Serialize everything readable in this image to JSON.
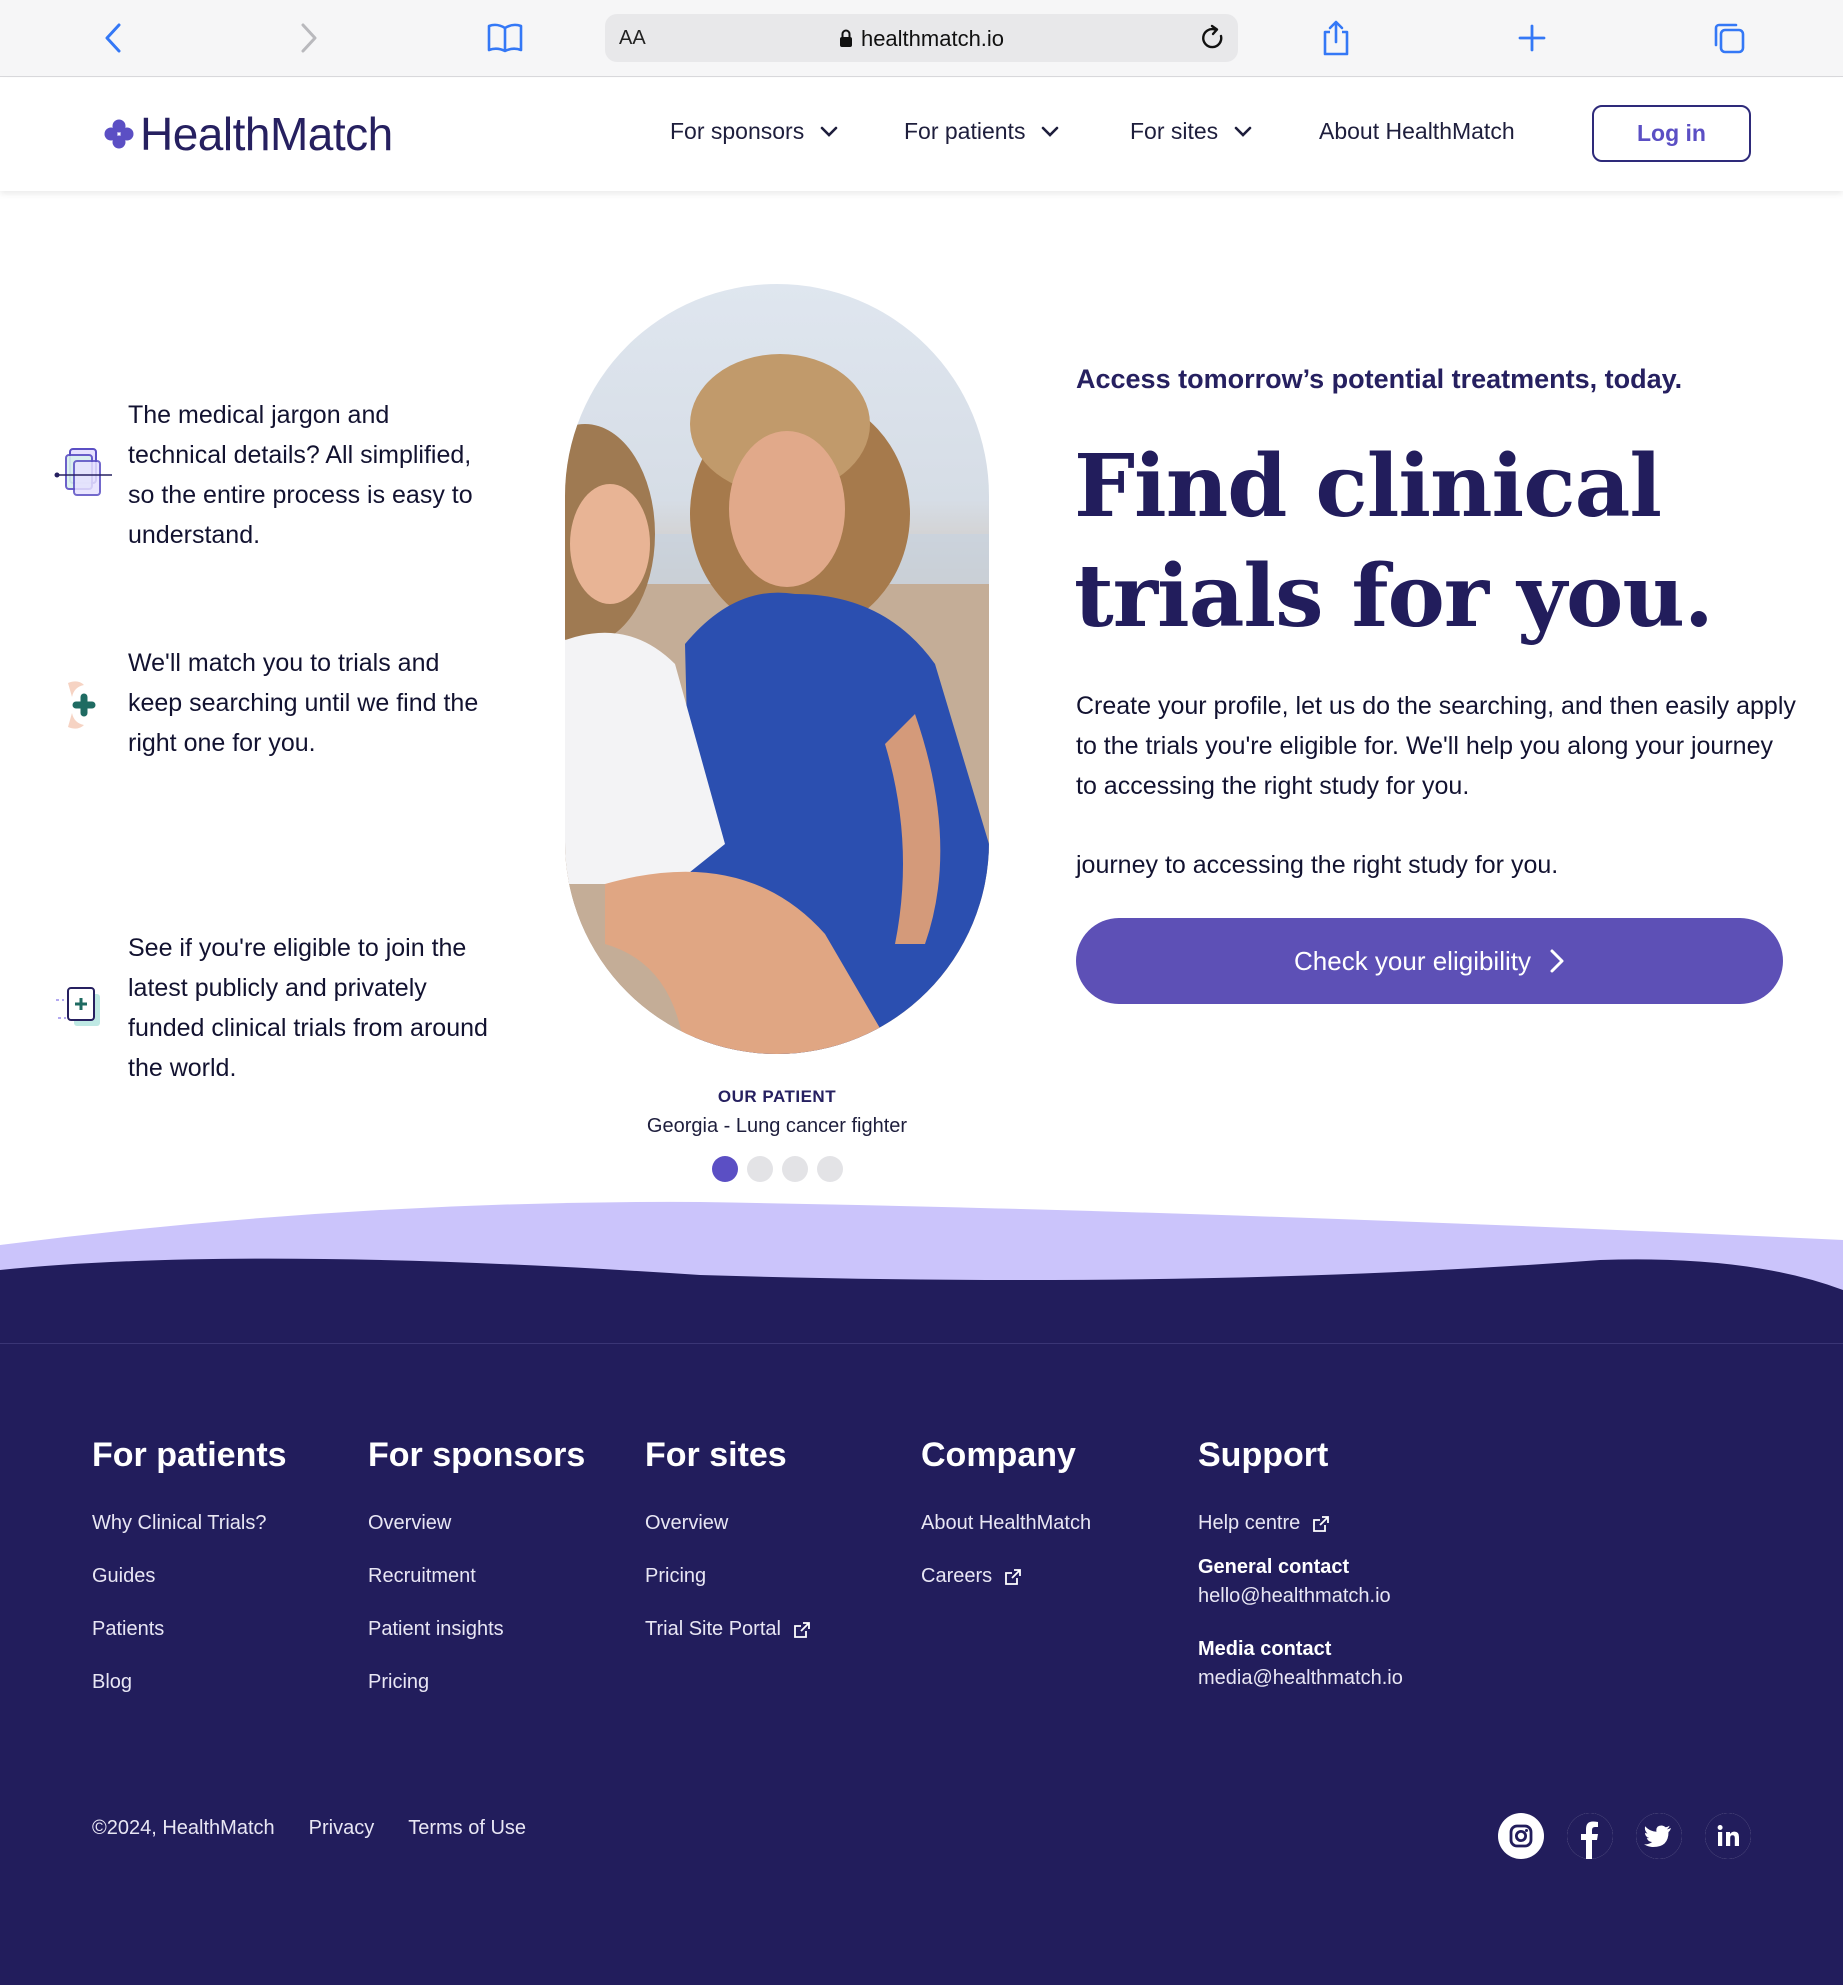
{
  "browser": {
    "text_size_label": "AA",
    "url": "healthmatch.io"
  },
  "nav": {
    "logo_text": "HealthMatch",
    "items": [
      {
        "label": "For sponsors"
      },
      {
        "label": "For patients"
      },
      {
        "label": "For sites"
      },
      {
        "label": "About HealthMatch"
      }
    ],
    "login_label": "Log in"
  },
  "features": [
    {
      "text": "The medical jargon and technical details? All simplified, so the entire process is easy to understand.",
      "icon": "documents-icon"
    },
    {
      "text": "We'll match you to trials and keep searching until we find the right one for you.",
      "icon": "hands-plus-icon"
    },
    {
      "text": "See if you're eligible to join the latest publicly and privately funded clinical trials from around the world.",
      "icon": "document-plus-icon"
    }
  ],
  "patient": {
    "label": "OUR PATIENT",
    "name": "Georgia - Lung cancer fighter",
    "carousel_count": 4,
    "active_index": 0
  },
  "hero": {
    "eyebrow": "Access tomorrow’s potential treatments, today.",
    "title": "Find clinical trials for you.",
    "body": "Create your profile, let us do the searching, and then easily apply to the trials you're eligible for. We'll help you along your journey to accessing the right study for you.",
    "body_overflow_line": "journey to accessing the right study for you.",
    "cta_label": "Check your eligibility"
  },
  "footer": {
    "columns": [
      {
        "heading": "For patients",
        "links": [
          "Why Clinical Trials?",
          "Guides",
          "Patients",
          "Blog"
        ]
      },
      {
        "heading": "For sponsors",
        "links": [
          "Overview",
          "Recruitment",
          "Patient insights",
          "Pricing"
        ]
      },
      {
        "heading": "For sites",
        "links": [
          "Overview",
          "Pricing",
          "Trial Site Portal"
        ]
      },
      {
        "heading": "Company",
        "links": [
          "About HealthMatch",
          "Careers"
        ]
      }
    ],
    "support": {
      "heading": "Support",
      "help_label": "Help centre",
      "general_contact_label": "General contact",
      "general_contact_email": "hello@healthmatch.io",
      "media_contact_label": "Media contact",
      "media_contact_email": "media@healthmatch.io"
    },
    "copyright": "©2024, HealthMatch",
    "privacy_label": "Privacy",
    "terms_label": "Terms of Use",
    "social": [
      "instagram-icon",
      "facebook-icon",
      "twitter-icon",
      "linkedin-icon"
    ]
  },
  "colors": {
    "brand_dark": "#221d5c",
    "brand_purple": "#5d50b6",
    "wave_lavender": "#cbc4fb"
  }
}
